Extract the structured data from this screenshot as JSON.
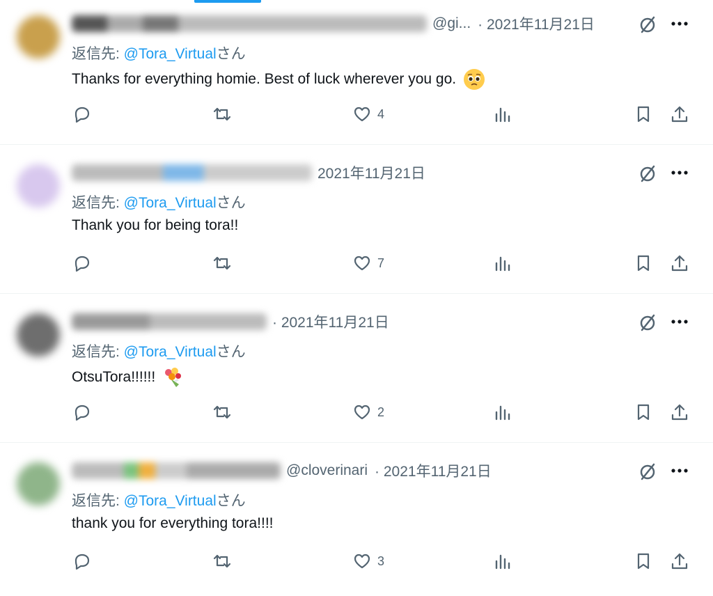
{
  "tweets": [
    {
      "handle": "@gi...",
      "date": "· 2021年11月21日",
      "reply_prefix": "返信先: ",
      "reply_handle": "@Tora_Virtual",
      "reply_suffix": "さん",
      "text": "Thanks for everything homie. Best of luck wherever you go.",
      "emoji": "pleading-face",
      "likes": "4",
      "avatar_color": "#c9a04d"
    },
    {
      "handle": "",
      "date": "2021年11月21日",
      "reply_prefix": "返信先: ",
      "reply_handle": "@Tora_Virtual",
      "reply_suffix": "さん",
      "text": "Thank you for being tora!!",
      "emoji": "",
      "likes": "7",
      "avatar_color": "#d8c8ee"
    },
    {
      "handle": "",
      "date": "· 2021年11月21日",
      "reply_prefix": "返信先: ",
      "reply_handle": "@Tora_Virtual",
      "reply_suffix": "さん",
      "text": "OtsuTora!!!!!!",
      "emoji": "bouquet",
      "likes": "2",
      "avatar_color": "#6e6e6e"
    },
    {
      "handle": "@cloverinari",
      "date": "· 2021年11月21日",
      "reply_prefix": "返信先: ",
      "reply_handle": "@Tora_Virtual",
      "reply_suffix": "さん",
      "text": "thank you for everything tora!!!!",
      "emoji": "",
      "likes": "3",
      "avatar_color": "#8fb58a"
    }
  ],
  "icons": {
    "reply": "reply-icon",
    "retweet": "retweet-icon",
    "like": "like-icon",
    "views": "views-icon",
    "bookmark": "bookmark-icon",
    "share": "share-icon",
    "grok": "ghost-slash-icon",
    "more": "more-icon"
  },
  "colors": {
    "accent": "#1d9bf0",
    "muted": "#536471",
    "text": "#0f1419"
  }
}
